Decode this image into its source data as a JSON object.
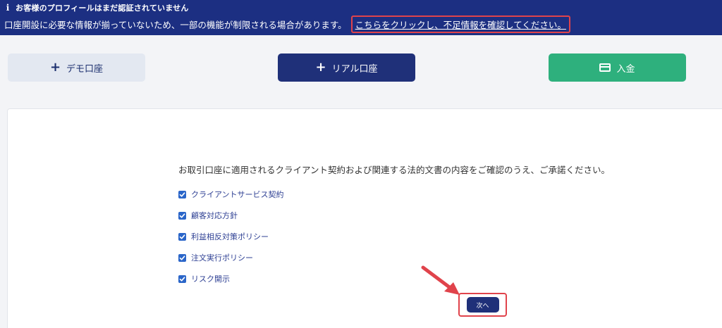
{
  "banner": {
    "title": "お客様のプロフィールはまだ認証されていません",
    "message": "口座開設に必要な情報が揃っていないため、一部の機能が制限される場合があります。",
    "link_text": "こちらをクリックし、不足情報を確認してください。",
    "icon": "info-icon"
  },
  "actions": {
    "demo_label": "デモ口座",
    "real_label": "リアル口座",
    "deposit_label": "入金"
  },
  "agreement": {
    "instruction": "お取引口座に適用されるクライアント契約および関連する法的文書の内容をご確認のうえ、ご承諾ください。",
    "documents": [
      {
        "label": "クライアントサービス契約",
        "checked": true
      },
      {
        "label": "顧客対応方針",
        "checked": true
      },
      {
        "label": "利益相反対策ポリシー",
        "checked": true
      },
      {
        "label": "注文実行ポリシー",
        "checked": true
      },
      {
        "label": "リスク開示",
        "checked": true
      }
    ],
    "next_label": "次へ"
  },
  "colors": {
    "banner_bg": "#1c2f82",
    "primary": "#1f3079",
    "deposit": "#2eb07d",
    "highlight": "#e0434b",
    "checkbox": "#2b66c9"
  }
}
